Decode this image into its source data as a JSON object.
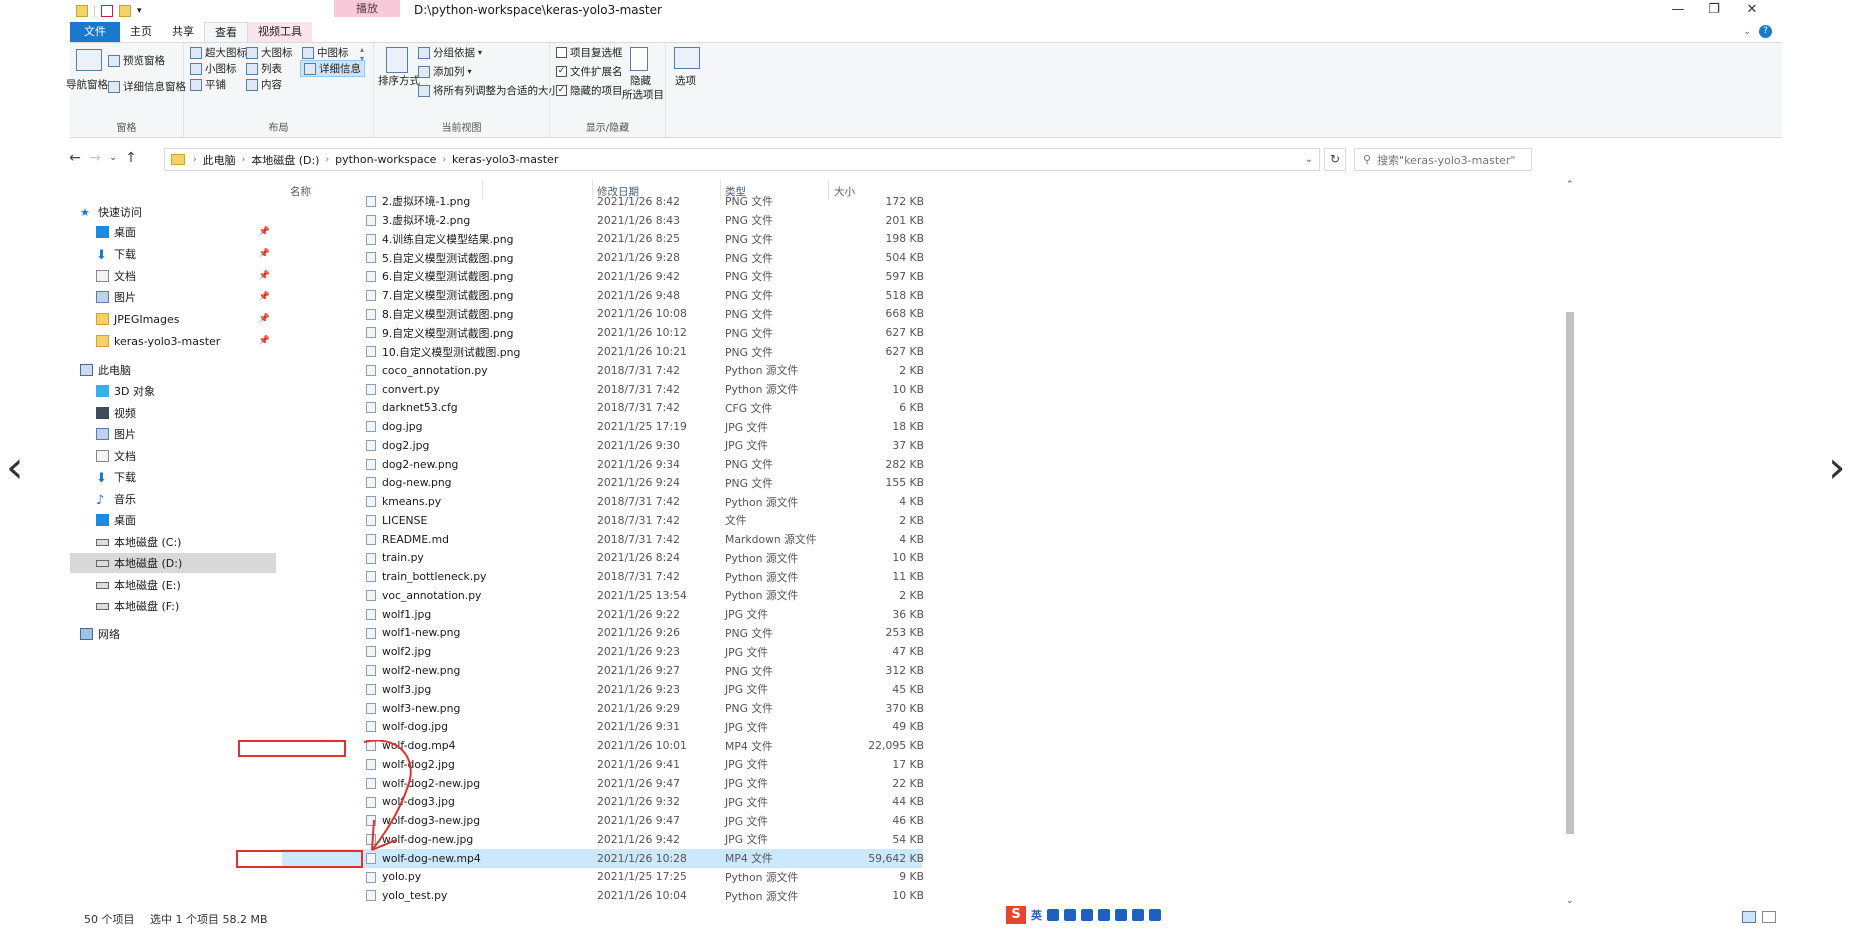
{
  "window": {
    "title_path": "D:\\python-workspace\\keras-yolo3-master",
    "tool_header": "播放"
  },
  "ribbon_tabs": [
    "文件",
    "主页",
    "共享",
    "查看",
    "视频工具"
  ],
  "ribbon": {
    "pane_group": {
      "nav_pane": "导航窗格",
      "preview_pane": "预览窗格",
      "details_pane": "详细信息窗格",
      "label": "窗格"
    },
    "layout_group": {
      "items": [
        "超大图标",
        "大图标",
        "中图标",
        "小图标",
        "列表",
        "详细信息",
        "平铺",
        "内容"
      ],
      "label": "布局"
    },
    "current_view_group": {
      "sort_by": "排序方式",
      "group_by": "分组依据",
      "add_column": "添加列",
      "fit_columns": "将所有列调整为合适的大小",
      "label": "当前视图"
    },
    "show_hide_group": {
      "item_checkboxes": "项目复选框",
      "file_extensions": "文件扩展名",
      "hidden_items": "隐藏的项目",
      "hide_selected_1": "隐藏",
      "hide_selected_2": "所选项目",
      "label": "显示/隐藏"
    },
    "options": "选项"
  },
  "address": {
    "crumbs": [
      "此电脑",
      "本地磁盘 (D:)",
      "python-workspace",
      "keras-yolo3-master"
    ],
    "search_placeholder": "搜索\"keras-yolo3-master\""
  },
  "nav_pane": {
    "quick_access": "快速访问",
    "quick_items": [
      "桌面",
      "下载",
      "文档",
      "图片",
      "JPEGImages",
      "keras-yolo3-master"
    ],
    "this_pc": "此电脑",
    "pc_items": [
      "3D 对象",
      "视频",
      "图片",
      "文档",
      "下载",
      "音乐",
      "桌面",
      "本地磁盘 (C:)",
      "本地磁盘 (D:)",
      "本地磁盘 (E:)",
      "本地磁盘 (F:)"
    ],
    "network": "网络"
  },
  "columns": {
    "name": "名称",
    "date": "修改日期",
    "type": "类型",
    "size": "大小"
  },
  "files": [
    {
      "name": "2.虚拟环境-1.png",
      "date": "2021/1/26 8:42",
      "type": "PNG 文件",
      "size": "172 KB"
    },
    {
      "name": "3.虚拟环境-2.png",
      "date": "2021/1/26 8:43",
      "type": "PNG 文件",
      "size": "201 KB"
    },
    {
      "name": "4.训练自定义模型结果.png",
      "date": "2021/1/26 8:25",
      "type": "PNG 文件",
      "size": "198 KB"
    },
    {
      "name": "5.自定义模型测试截图.png",
      "date": "2021/1/26 9:28",
      "type": "PNG 文件",
      "size": "504 KB"
    },
    {
      "name": "6.自定义模型测试截图.png",
      "date": "2021/1/26 9:42",
      "type": "PNG 文件",
      "size": "597 KB"
    },
    {
      "name": "7.自定义模型测试截图.png",
      "date": "2021/1/26 9:48",
      "type": "PNG 文件",
      "size": "518 KB"
    },
    {
      "name": "8.自定义模型测试截图.png",
      "date": "2021/1/26 10:08",
      "type": "PNG 文件",
      "size": "668 KB"
    },
    {
      "name": "9.自定义模型测试截图.png",
      "date": "2021/1/26 10:12",
      "type": "PNG 文件",
      "size": "627 KB"
    },
    {
      "name": "10.自定义模型测试截图.png",
      "date": "2021/1/26 10:21",
      "type": "PNG 文件",
      "size": "627 KB"
    },
    {
      "name": "coco_annotation.py",
      "date": "2018/7/31 7:42",
      "type": "Python 源文件",
      "size": "2 KB"
    },
    {
      "name": "convert.py",
      "date": "2018/7/31 7:42",
      "type": "Python 源文件",
      "size": "10 KB"
    },
    {
      "name": "darknet53.cfg",
      "date": "2018/7/31 7:42",
      "type": "CFG 文件",
      "size": "6 KB"
    },
    {
      "name": "dog.jpg",
      "date": "2021/1/25 17:19",
      "type": "JPG 文件",
      "size": "18 KB"
    },
    {
      "name": "dog2.jpg",
      "date": "2021/1/26 9:30",
      "type": "JPG 文件",
      "size": "37 KB"
    },
    {
      "name": "dog2-new.png",
      "date": "2021/1/26 9:34",
      "type": "PNG 文件",
      "size": "282 KB"
    },
    {
      "name": "dog-new.png",
      "date": "2021/1/26 9:24",
      "type": "PNG 文件",
      "size": "155 KB"
    },
    {
      "name": "kmeans.py",
      "date": "2018/7/31 7:42",
      "type": "Python 源文件",
      "size": "4 KB"
    },
    {
      "name": "LICENSE",
      "date": "2018/7/31 7:42",
      "type": "文件",
      "size": "2 KB"
    },
    {
      "name": "README.md",
      "date": "2018/7/31 7:42",
      "type": "Markdown 源文件",
      "size": "4 KB"
    },
    {
      "name": "train.py",
      "date": "2021/1/26 8:24",
      "type": "Python 源文件",
      "size": "10 KB"
    },
    {
      "name": "train_bottleneck.py",
      "date": "2018/7/31 7:42",
      "type": "Python 源文件",
      "size": "11 KB"
    },
    {
      "name": "voc_annotation.py",
      "date": "2021/1/25 13:54",
      "type": "Python 源文件",
      "size": "2 KB"
    },
    {
      "name": "wolf1.jpg",
      "date": "2021/1/26 9:22",
      "type": "JPG 文件",
      "size": "36 KB"
    },
    {
      "name": "wolf1-new.png",
      "date": "2021/1/26 9:26",
      "type": "PNG 文件",
      "size": "253 KB"
    },
    {
      "name": "wolf2.jpg",
      "date": "2021/1/26 9:23",
      "type": "JPG 文件",
      "size": "47 KB"
    },
    {
      "name": "wolf2-new.png",
      "date": "2021/1/26 9:27",
      "type": "PNG 文件",
      "size": "312 KB"
    },
    {
      "name": "wolf3.jpg",
      "date": "2021/1/26 9:23",
      "type": "JPG 文件",
      "size": "45 KB"
    },
    {
      "name": "wolf3-new.png",
      "date": "2021/1/26 9:29",
      "type": "PNG 文件",
      "size": "370 KB"
    },
    {
      "name": "wolf-dog.jpg",
      "date": "2021/1/26 9:31",
      "type": "JPG 文件",
      "size": "49 KB"
    },
    {
      "name": "wolf-dog.mp4",
      "date": "2021/1/26 10:01",
      "type": "MP4 文件",
      "size": "22,095 KB"
    },
    {
      "name": "wolf-dog2.jpg",
      "date": "2021/1/26 9:41",
      "type": "JPG 文件",
      "size": "17 KB"
    },
    {
      "name": "wolf-dog2-new.jpg",
      "date": "2021/1/26 9:47",
      "type": "JPG 文件",
      "size": "22 KB"
    },
    {
      "name": "wolf-dog3.jpg",
      "date": "2021/1/26 9:32",
      "type": "JPG 文件",
      "size": "44 KB"
    },
    {
      "name": "wolf-dog3-new.jpg",
      "date": "2021/1/26 9:47",
      "type": "JPG 文件",
      "size": "46 KB"
    },
    {
      "name": "wolf-dog-new.jpg",
      "date": "2021/1/26 9:42",
      "type": "JPG 文件",
      "size": "54 KB"
    },
    {
      "name": "wolf-dog-new.mp4",
      "date": "2021/1/26 10:28",
      "type": "MP4 文件",
      "size": "59,642 KB",
      "selected": true
    },
    {
      "name": "yolo.py",
      "date": "2021/1/25 17:25",
      "type": "Python 源文件",
      "size": "9 KB"
    },
    {
      "name": "yolo_test.py",
      "date": "2021/1/26 10:04",
      "type": "Python 源文件",
      "size": "10 KB"
    }
  ],
  "status": {
    "count": "50 个项目",
    "selected": "选中 1 个项目  58.2 MB"
  },
  "ime": {
    "lang": "英"
  },
  "colors": {
    "file_tab": "#1979ca",
    "selection": "#cce8ff",
    "annotation": "#e03131"
  }
}
